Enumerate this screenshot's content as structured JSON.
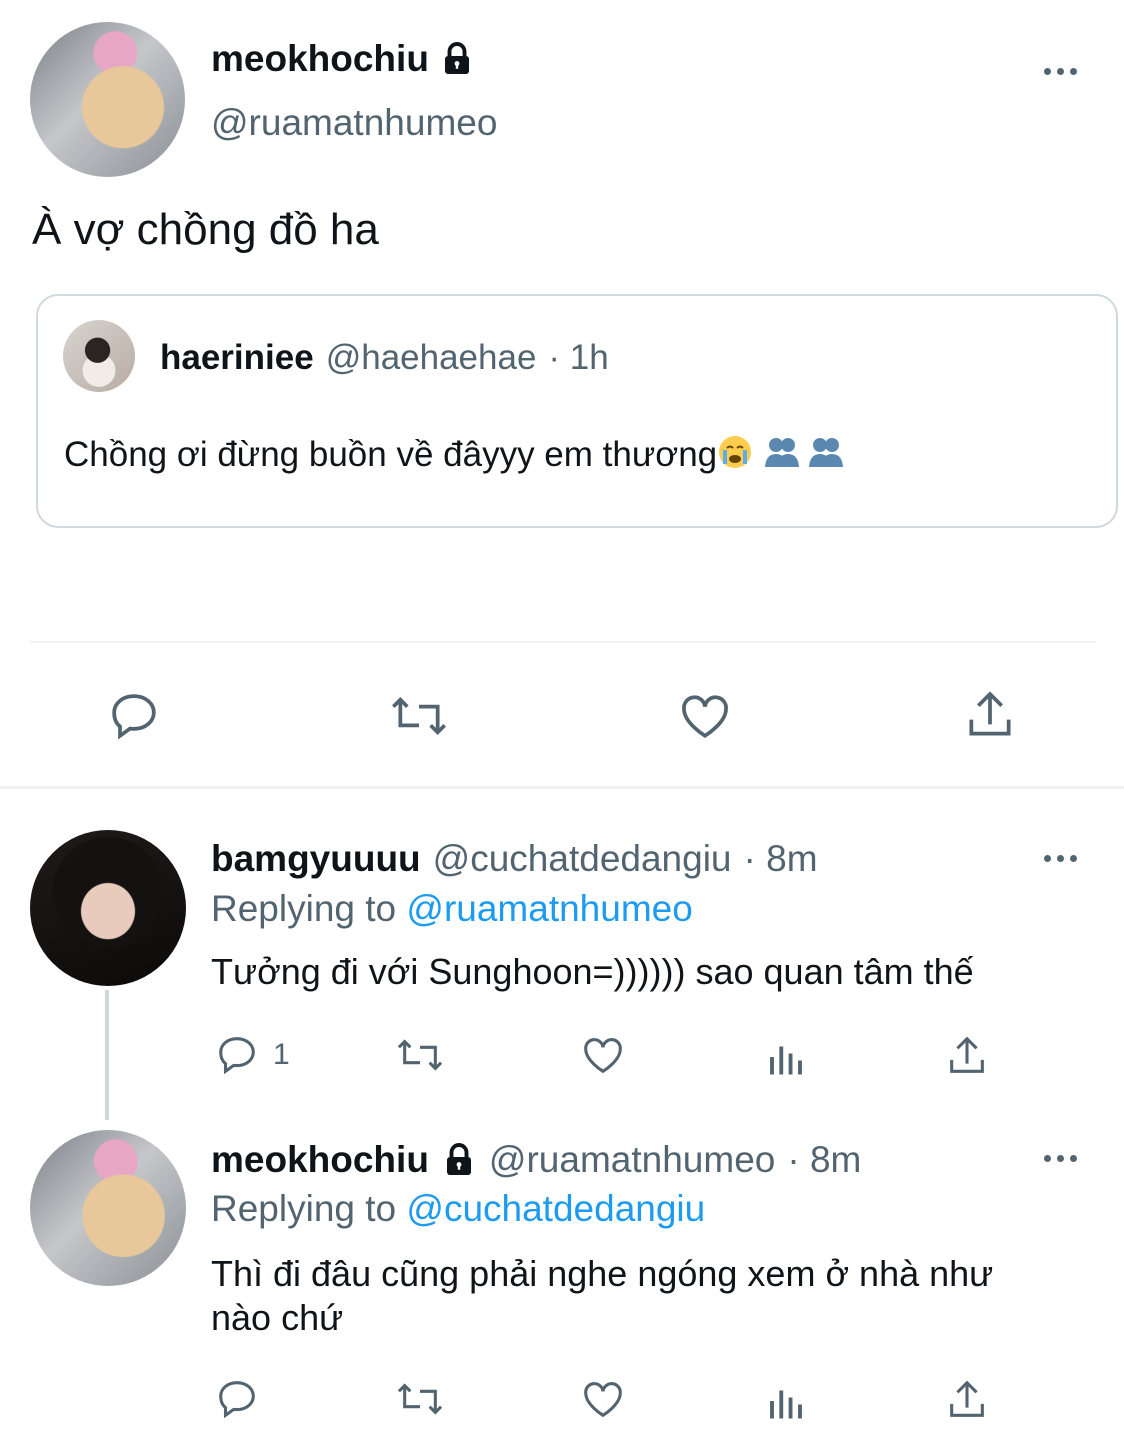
{
  "main_tweet": {
    "display_name": "meokhochiu",
    "handle": "@ruamatnhumeo",
    "text": "À vợ chồng đồ ha",
    "quoted": {
      "display_name": "haeriniee",
      "handle": "@haehaehae",
      "time": "· 1h",
      "text": "Chồng ơi đừng buồn về đâyyy em thương"
    }
  },
  "replies": [
    {
      "display_name": "bamgyuuuu",
      "handle": "@cuchatdedangiu",
      "time": "· 8m",
      "replying_label": "Replying to",
      "replying_to": "@ruamatnhumeo",
      "text": "Tưởng đi với Sunghoon=)))))) sao quan tâm thế",
      "reply_count": "1"
    },
    {
      "display_name": "meokhochiu",
      "handle": "@ruamatnhumeo",
      "time": "· 8m",
      "replying_label": "Replying to",
      "replying_to": "@cuchatdedangiu",
      "text_line1": "Thì đi đâu cũng phải nghe ngóng xem ở nhà như",
      "text_line2": "nào chứ"
    }
  ],
  "colors": {
    "accent": "#1d9bf0",
    "muted": "#536471",
    "text": "#0f1419",
    "border": "#cfd9de"
  }
}
